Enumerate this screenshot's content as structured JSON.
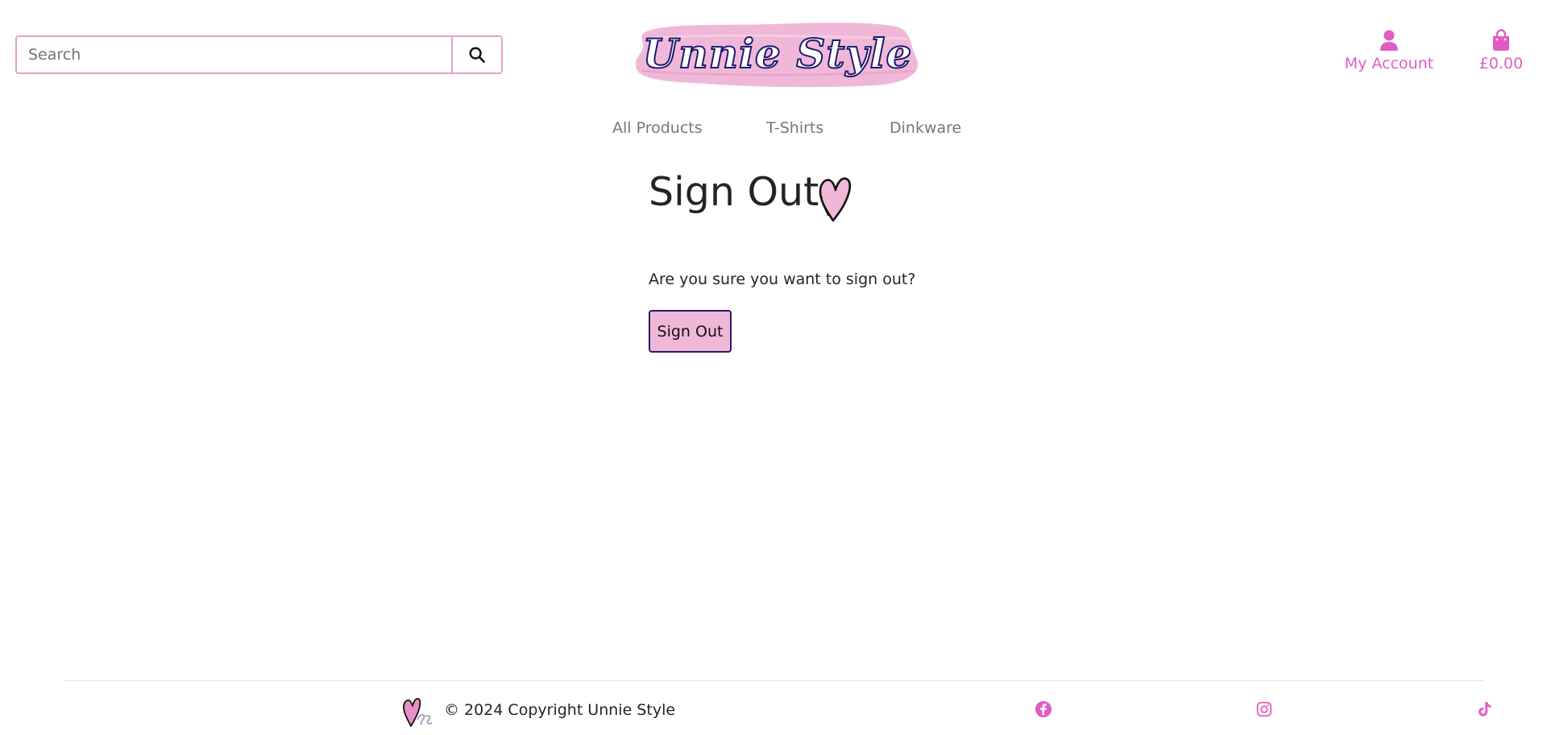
{
  "header": {
    "search": {
      "placeholder": "Search"
    },
    "logo_text": "Unnie Style",
    "account_label": "My Account",
    "cart_total": "£0.00"
  },
  "nav": {
    "items": [
      {
        "label": "All Products"
      },
      {
        "label": "T-Shirts"
      },
      {
        "label": "Dinkware"
      }
    ]
  },
  "main": {
    "title": "Sign Out",
    "confirm_text": "Are you sure you want to sign out?",
    "signout_button": "Sign Out"
  },
  "footer": {
    "copyright": "© 2024 Copyright Unnie Style",
    "social": [
      "facebook-icon",
      "instagram-icon",
      "tiktok-icon"
    ]
  },
  "colors": {
    "brand_pink": "#e05cc4",
    "logo_pink": "#f0b8d8",
    "logo_outline": "#1c1a6e",
    "button_border": "#2b1a66",
    "nav_text": "#777777",
    "search_border": "#e6a0c8"
  }
}
